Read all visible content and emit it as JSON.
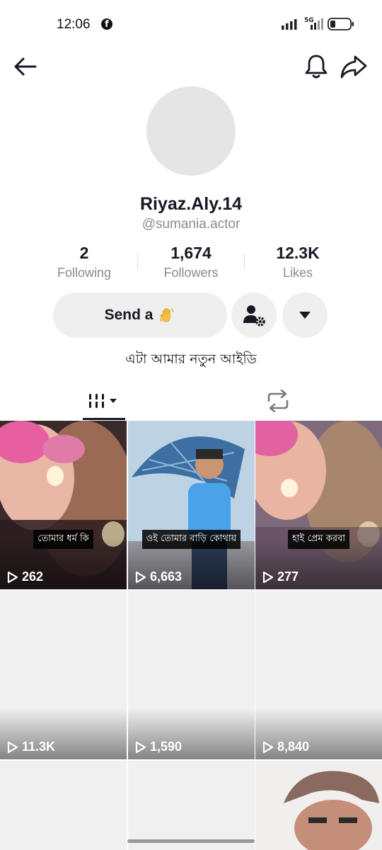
{
  "status_bar": {
    "time": "12:06",
    "network_label": "5G"
  },
  "profile": {
    "display_name": "Riyaz.Aly.14",
    "handle": "@sumania.actor",
    "bio": "এটা আমার নতুন আইডি"
  },
  "stats": [
    {
      "value": "2",
      "label": "Following"
    },
    {
      "value": "1,674",
      "label": "Followers"
    },
    {
      "value": "12.3K",
      "label": "Likes"
    }
  ],
  "actions": {
    "send_label": "Send a",
    "send_emoji_icon": "waving-hand-icon",
    "add_friend_icon": "add-friend-settings-icon",
    "more_icon": "caret-down-icon"
  },
  "tabs": {
    "videos_icon": "videos-grid-icon",
    "reposts_icon": "repost-icon"
  },
  "videos": [
    {
      "views": "262",
      "caption": "তোমার ধর্ম কি"
    },
    {
      "views": "6,663",
      "caption": "ওই তোমার বাড়ি কোথায়"
    },
    {
      "views": "277",
      "caption": "হাই প্রেম করবা"
    },
    {
      "views": "11.3K",
      "caption": ""
    },
    {
      "views": "1,590",
      "caption": ""
    },
    {
      "views": "8,840",
      "caption": ""
    },
    {
      "views": "",
      "caption": ""
    },
    {
      "views": "",
      "caption": ""
    },
    {
      "views": "",
      "caption": ""
    }
  ],
  "colors": {
    "text_primary": "#161823",
    "text_secondary": "#8a8b91",
    "button_bg": "#efefef"
  }
}
